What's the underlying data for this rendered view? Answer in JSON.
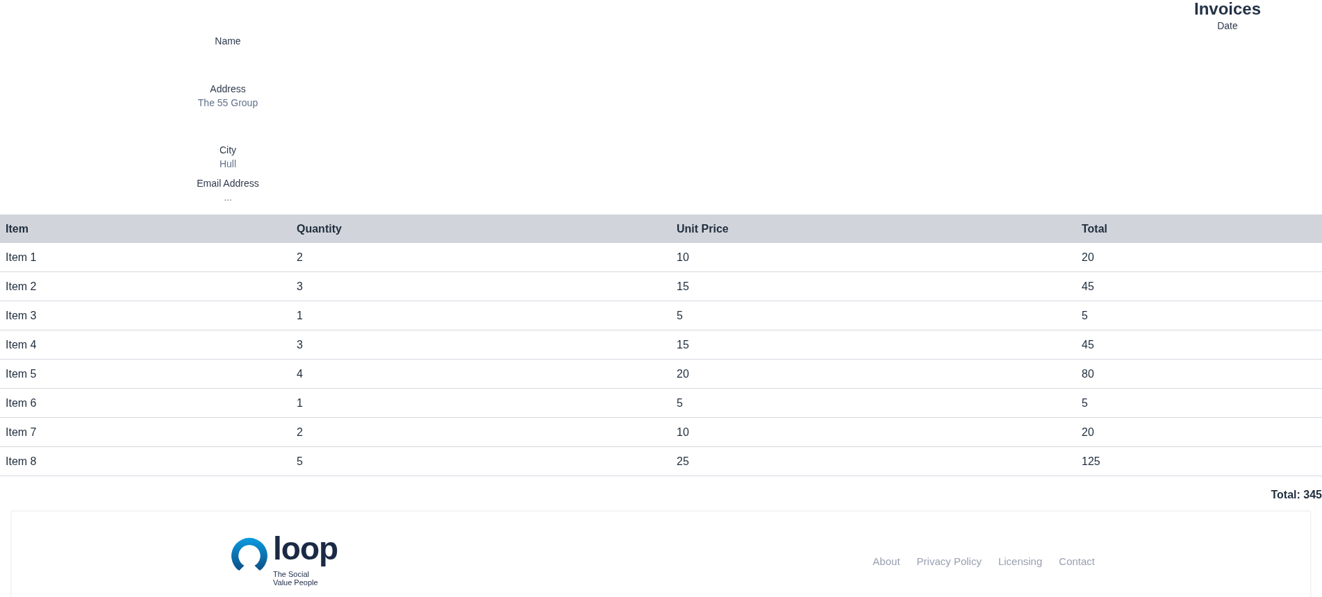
{
  "header": {
    "title": "Invoices",
    "date_label": "Date"
  },
  "customer": [
    {
      "label": "Name"
    },
    {
      "label": "Address",
      "value": "The 55 Group"
    },
    {
      "label": "City",
      "value": "Hull"
    },
    {
      "label": "Email Address",
      "value": "..."
    }
  ],
  "table": {
    "columns": [
      "Item",
      "Quantity",
      "Unit Price",
      "Total"
    ],
    "rows": [
      [
        "Item 1",
        "2",
        "10",
        "20"
      ],
      [
        "Item 2",
        "3",
        "15",
        "45"
      ],
      [
        "Item 3",
        "1",
        "5",
        "5"
      ],
      [
        "Item 4",
        "3",
        "15",
        "45"
      ],
      [
        "Item 5",
        "4",
        "20",
        "80"
      ],
      [
        "Item 6",
        "1",
        "5",
        "5"
      ],
      [
        "Item 7",
        "2",
        "10",
        "20"
      ],
      [
        "Item 8",
        "5",
        "25",
        "125"
      ]
    ]
  },
  "grand_total": "Total: 345",
  "footer": {
    "logo": {
      "wordmark": "loop",
      "tagline_lines": [
        "The Social",
        "Value People"
      ]
    },
    "links": [
      "About",
      "Privacy Policy",
      "Licensing",
      "Contact"
    ]
  }
}
